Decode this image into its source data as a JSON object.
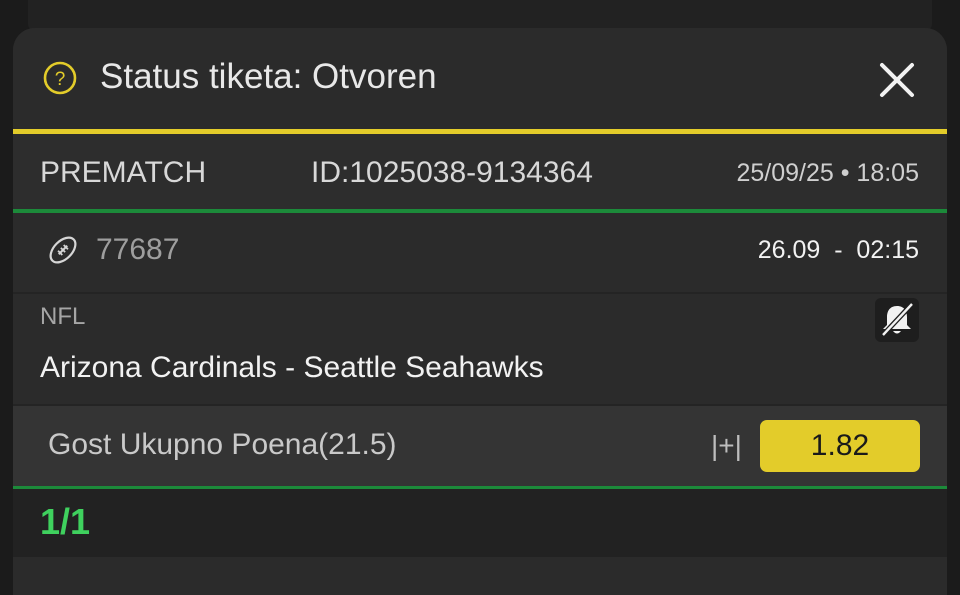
{
  "header": {
    "title": "Status tiketa: Otvoren",
    "help_icon": "question-circle-icon",
    "close_icon": "close-icon"
  },
  "ticket": {
    "type": "PREMATCH",
    "id": "ID:1025038-9134364",
    "datetime": "25/09/25 • 18:05"
  },
  "event": {
    "sport_icon": "american-football-icon",
    "code": "77687",
    "start": "26.09  -  02:15",
    "league": "NFL",
    "notification_icon": "bell-off-icon",
    "match": "Arizona Cardinals - Seattle Seahawks"
  },
  "selection": {
    "market": "Gost Ukupno Poena(21.5)",
    "flag": "|+|",
    "odds": "1.82"
  },
  "summary": {
    "count": "1/1"
  },
  "colors": {
    "accent_yellow": "#e3cc2a",
    "accent_green": "#1c8a3a",
    "count_green": "#3fd15e",
    "background": "#2b2b2b"
  }
}
